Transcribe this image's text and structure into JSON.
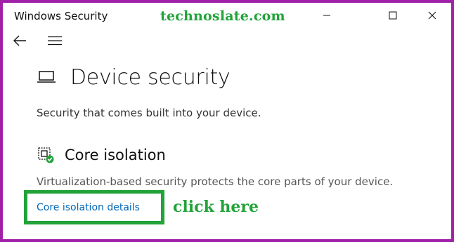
{
  "window": {
    "title": "Windows Security",
    "controls": {
      "minimize_icon": "minimize-icon",
      "maximize_icon": "maximize-icon",
      "close_icon": "close-icon"
    }
  },
  "watermark": "technoslate.com",
  "nav": {
    "back_icon": "back-arrow-icon",
    "menu_icon": "hamburger-menu-icon"
  },
  "page": {
    "icon": "laptop-icon",
    "title": "Device security",
    "subtitle": "Security that comes built into your device."
  },
  "core_isolation": {
    "icon": "core-isolation-chip-check-icon",
    "title": "Core isolation",
    "description": "Virtualization-based security protects the core parts of your device.",
    "link": "Core isolation details"
  },
  "annotation": {
    "text": "click here",
    "color": "#22a33a"
  },
  "colors": {
    "frame_border": "#a020a8",
    "link": "#0067b8",
    "highlight": "#22a33a"
  }
}
